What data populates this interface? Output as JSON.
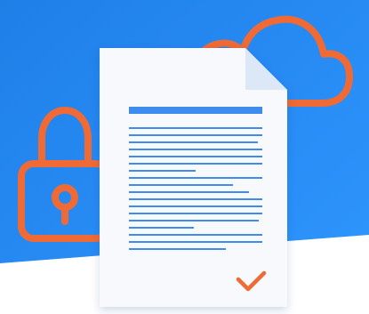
{
  "colors": {
    "background_start": "#1f7fe8",
    "background_end": "#2f97ff",
    "accent_orange": "#ef6a35",
    "document_page": "#f7f9fc",
    "document_fold": "#dce8f7",
    "text_blue": "#3d8df0"
  },
  "icons": {
    "lock": "lock-icon",
    "cloud": "cloud-icon",
    "document": "document-icon",
    "check": "checkmark-icon"
  }
}
